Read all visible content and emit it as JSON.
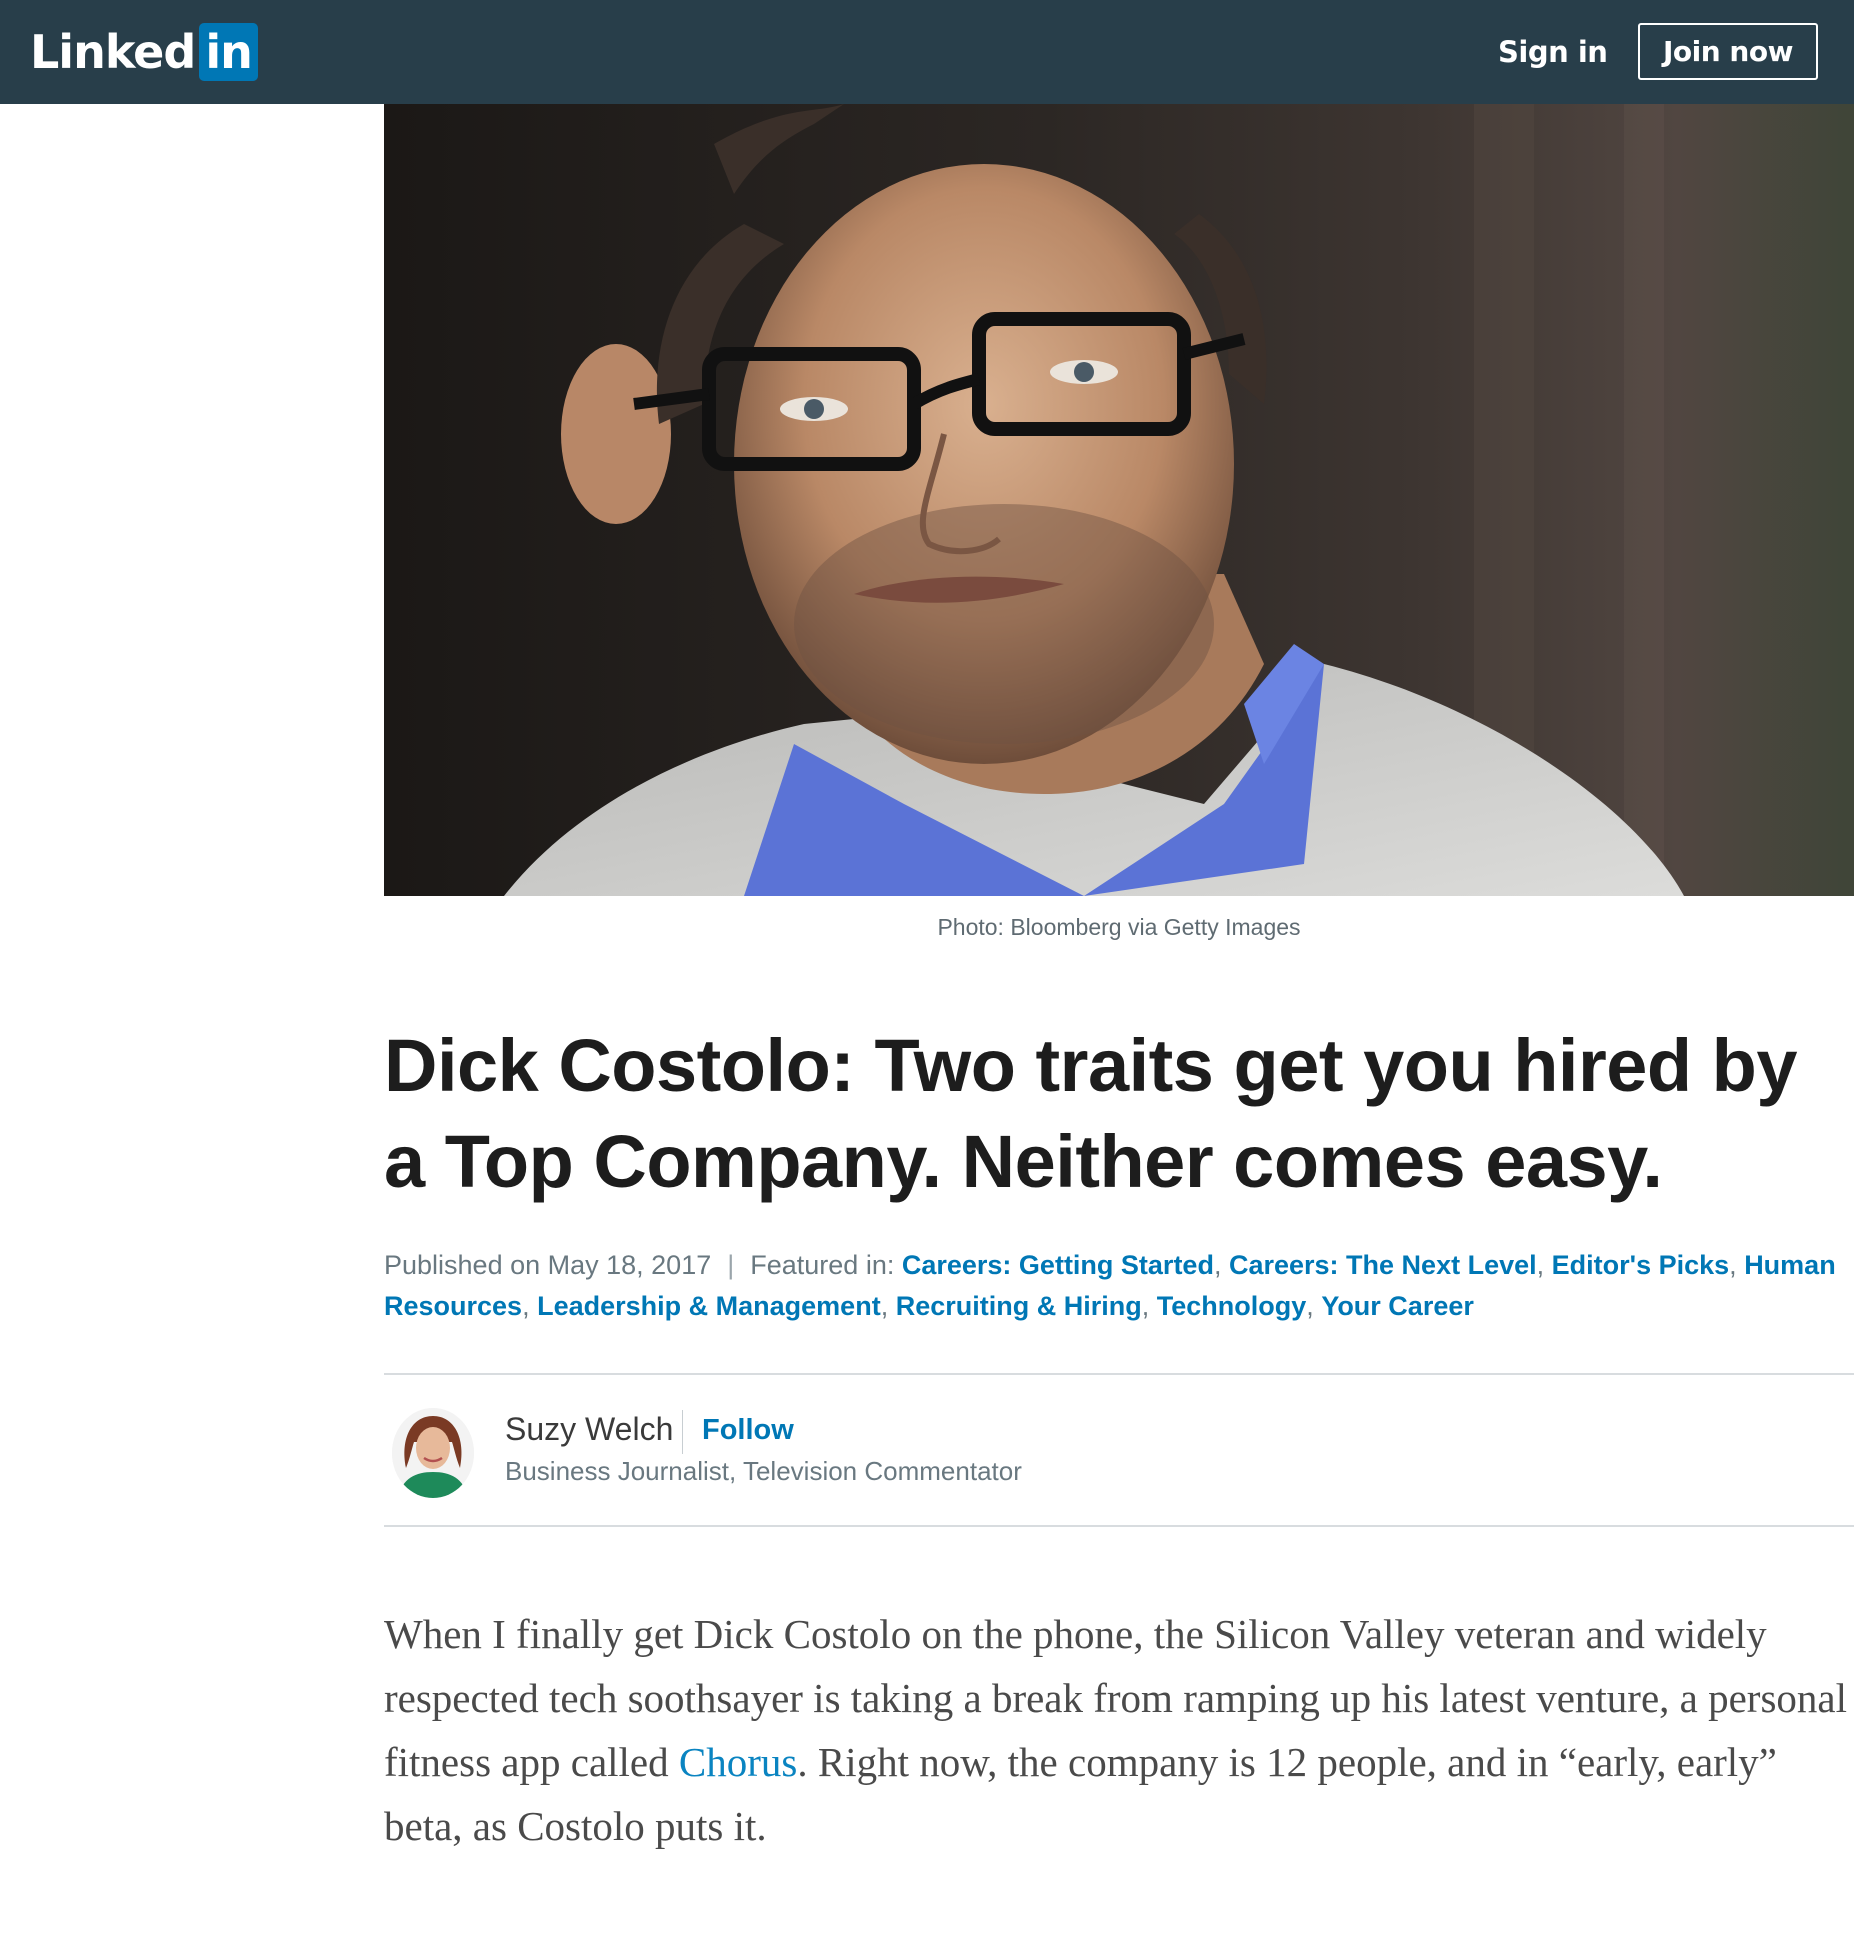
{
  "header": {
    "logo_text": "Linked",
    "logo_badge": "in",
    "signin_label": "Sign in",
    "join_label": "Join now",
    "bg_color": "#283e4a",
    "brand_color": "#0077b5"
  },
  "hero": {
    "caption": "Photo: Bloomberg via Getty Images"
  },
  "article": {
    "title": "Dick Costolo: Two traits get you hired by a Top Company. Neither comes easy.",
    "published": "Published on May 18, 2017",
    "separator": "|",
    "featured_label": "Featured in:",
    "featured": [
      "Careers: Getting Started",
      "Careers: The Next Level",
      "Editor's Picks",
      "Human Resources",
      "Leadership & Management",
      "Recruiting & Hiring",
      "Technology",
      "Your Career"
    ],
    "comma": ","
  },
  "author": {
    "name": "Suzy Welch",
    "follow_label": "Follow",
    "title": "Business Journalist, Television Commentator"
  },
  "body": {
    "para1_before": "When I finally get Dick Costolo on the phone, the Silicon Valley veteran and widely respected tech soothsayer is taking a break from ramping up his latest venture, a personal fitness app called ",
    "para1_link": "Chorus",
    "para1_after": ". Right now, the company is 12 people, and in “early, early” beta, as Costolo puts it."
  }
}
